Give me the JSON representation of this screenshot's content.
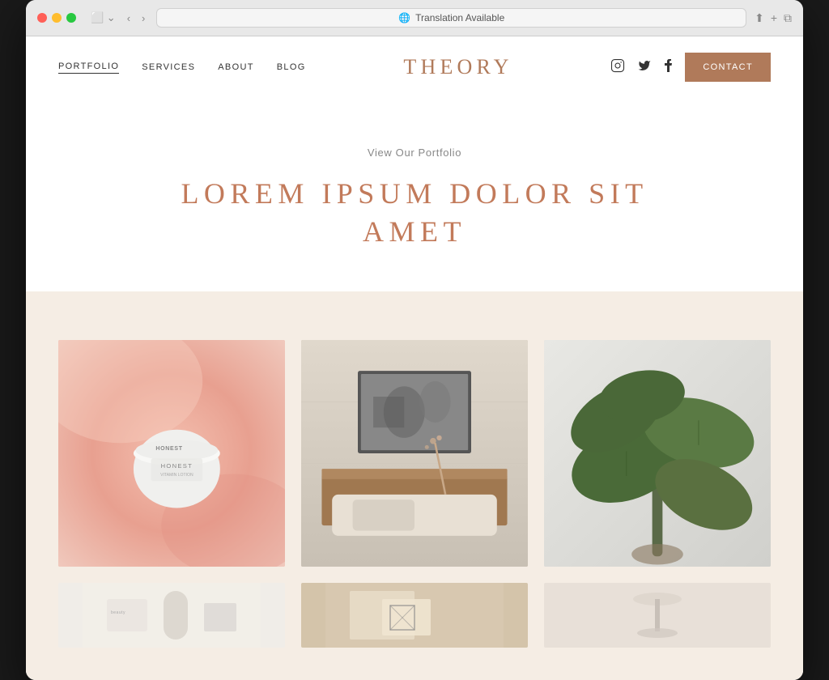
{
  "browser": {
    "address_bar_text": "Translation Available",
    "back_btn": "‹",
    "forward_btn": "›"
  },
  "nav": {
    "links": [
      {
        "label": "PORTFOLIO",
        "active": true
      },
      {
        "label": "SERVICES",
        "active": false
      },
      {
        "label": "ABOUT",
        "active": false
      },
      {
        "label": "BLOG",
        "active": false
      }
    ],
    "brand": "THEORY",
    "contact_label": "CONTACT",
    "social": [
      {
        "name": "instagram",
        "icon": "Instagram"
      },
      {
        "name": "twitter",
        "icon": "Twitter"
      },
      {
        "name": "facebook",
        "icon": "Facebook"
      }
    ]
  },
  "hero": {
    "subtitle": "View Our Portfolio",
    "title_line1": "LOREM IPSUM DOLOR SIT",
    "title_line2": "AMET"
  },
  "portfolio": {
    "images": [
      {
        "alt": "Honest cream product on pink fabric"
      },
      {
        "alt": "Sofa with art print and floral arrangement"
      },
      {
        "alt": "Green rubber plant on light background"
      }
    ],
    "images_bottom": [
      {
        "alt": "Beauty products flatlay"
      },
      {
        "alt": "Paper and geometric shapes"
      },
      {
        "alt": "Light decorative item"
      }
    ]
  },
  "colors": {
    "brand": "#b07a5a",
    "hero_title": "#c27a5a",
    "contact_btn_bg": "#b07a5a",
    "portfolio_bg": "#f5ede4",
    "accent_text": "#888888"
  }
}
